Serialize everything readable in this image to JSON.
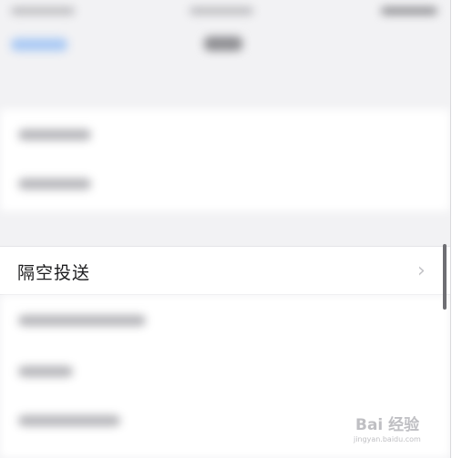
{
  "settings": {
    "airdrop_row": {
      "label": "隔空投送",
      "chevron": "›"
    }
  },
  "watermark": {
    "brand": "Bai 经验",
    "url": "jingyan.baidu.com"
  },
  "colors": {
    "link_blue": "#a9c9f4",
    "group_bg": "#f2f2f4",
    "row_bg": "#ffffff"
  }
}
